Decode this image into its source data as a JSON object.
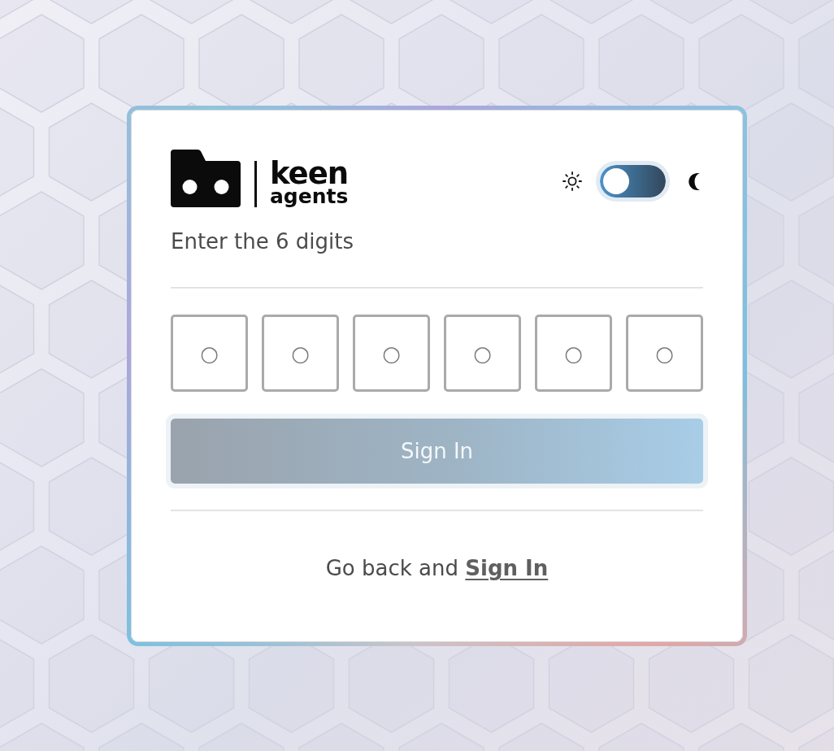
{
  "logo": {
    "word_top": "keen",
    "word_bottom": "agents"
  },
  "theme_toggle": {
    "on": false
  },
  "prompt": "Enter the 6 digits",
  "code_fields": [
    {
      "placeholder": "○"
    },
    {
      "placeholder": "○"
    },
    {
      "placeholder": "○"
    },
    {
      "placeholder": "○"
    },
    {
      "placeholder": "○"
    },
    {
      "placeholder": "○"
    }
  ],
  "submit_button": {
    "label": "Sign In",
    "disabled": true
  },
  "footer": {
    "text": "Go back and",
    "link": "Sign In"
  }
}
